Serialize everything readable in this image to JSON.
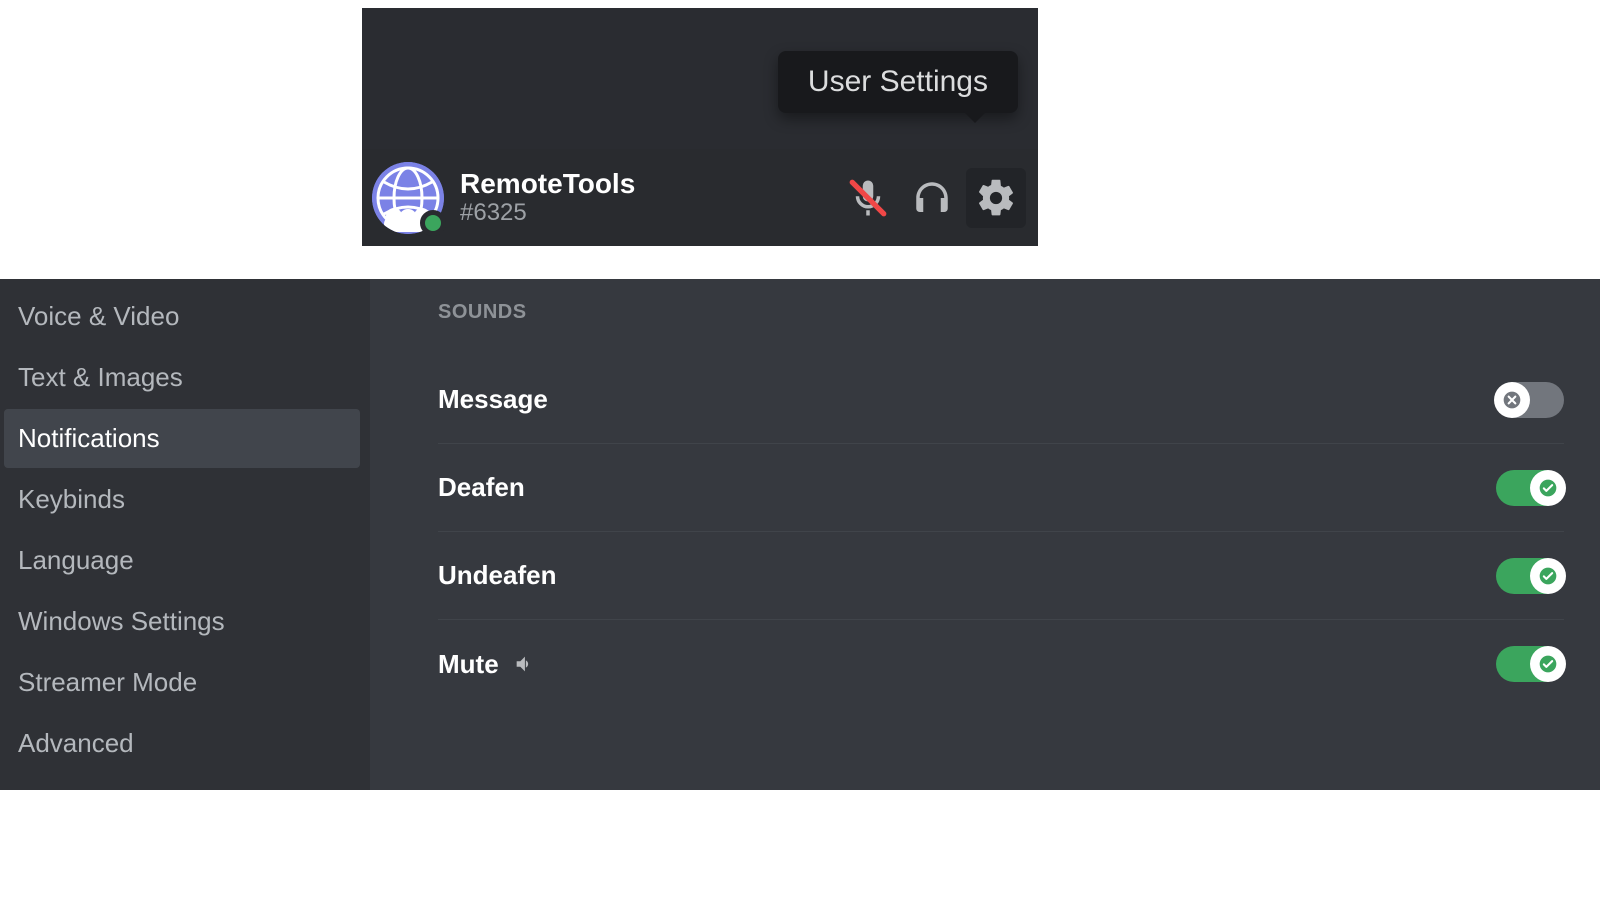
{
  "user_panel": {
    "tooltip": "User Settings",
    "username": "RemoteTools",
    "discriminator": "#6325",
    "status": "online",
    "mic_muted": true
  },
  "sidebar": {
    "items": [
      {
        "label": "Voice & Video",
        "selected": false
      },
      {
        "label": "Text & Images",
        "selected": false
      },
      {
        "label": "Notifications",
        "selected": true
      },
      {
        "label": "Keybinds",
        "selected": false
      },
      {
        "label": "Language",
        "selected": false
      },
      {
        "label": "Windows Settings",
        "selected": false
      },
      {
        "label": "Streamer Mode",
        "selected": false
      },
      {
        "label": "Advanced",
        "selected": false
      }
    ]
  },
  "content": {
    "section_header": "Sounds",
    "sounds": [
      {
        "label": "Message",
        "enabled": false,
        "preview": false
      },
      {
        "label": "Deafen",
        "enabled": true,
        "preview": false
      },
      {
        "label": "Undeafen",
        "enabled": true,
        "preview": false
      },
      {
        "label": "Mute",
        "enabled": true,
        "preview": true
      }
    ]
  },
  "colors": {
    "green": "#3ba55d",
    "grey": "#72767d",
    "bg_dark": "#2f3136",
    "bg_main": "#36393f"
  }
}
